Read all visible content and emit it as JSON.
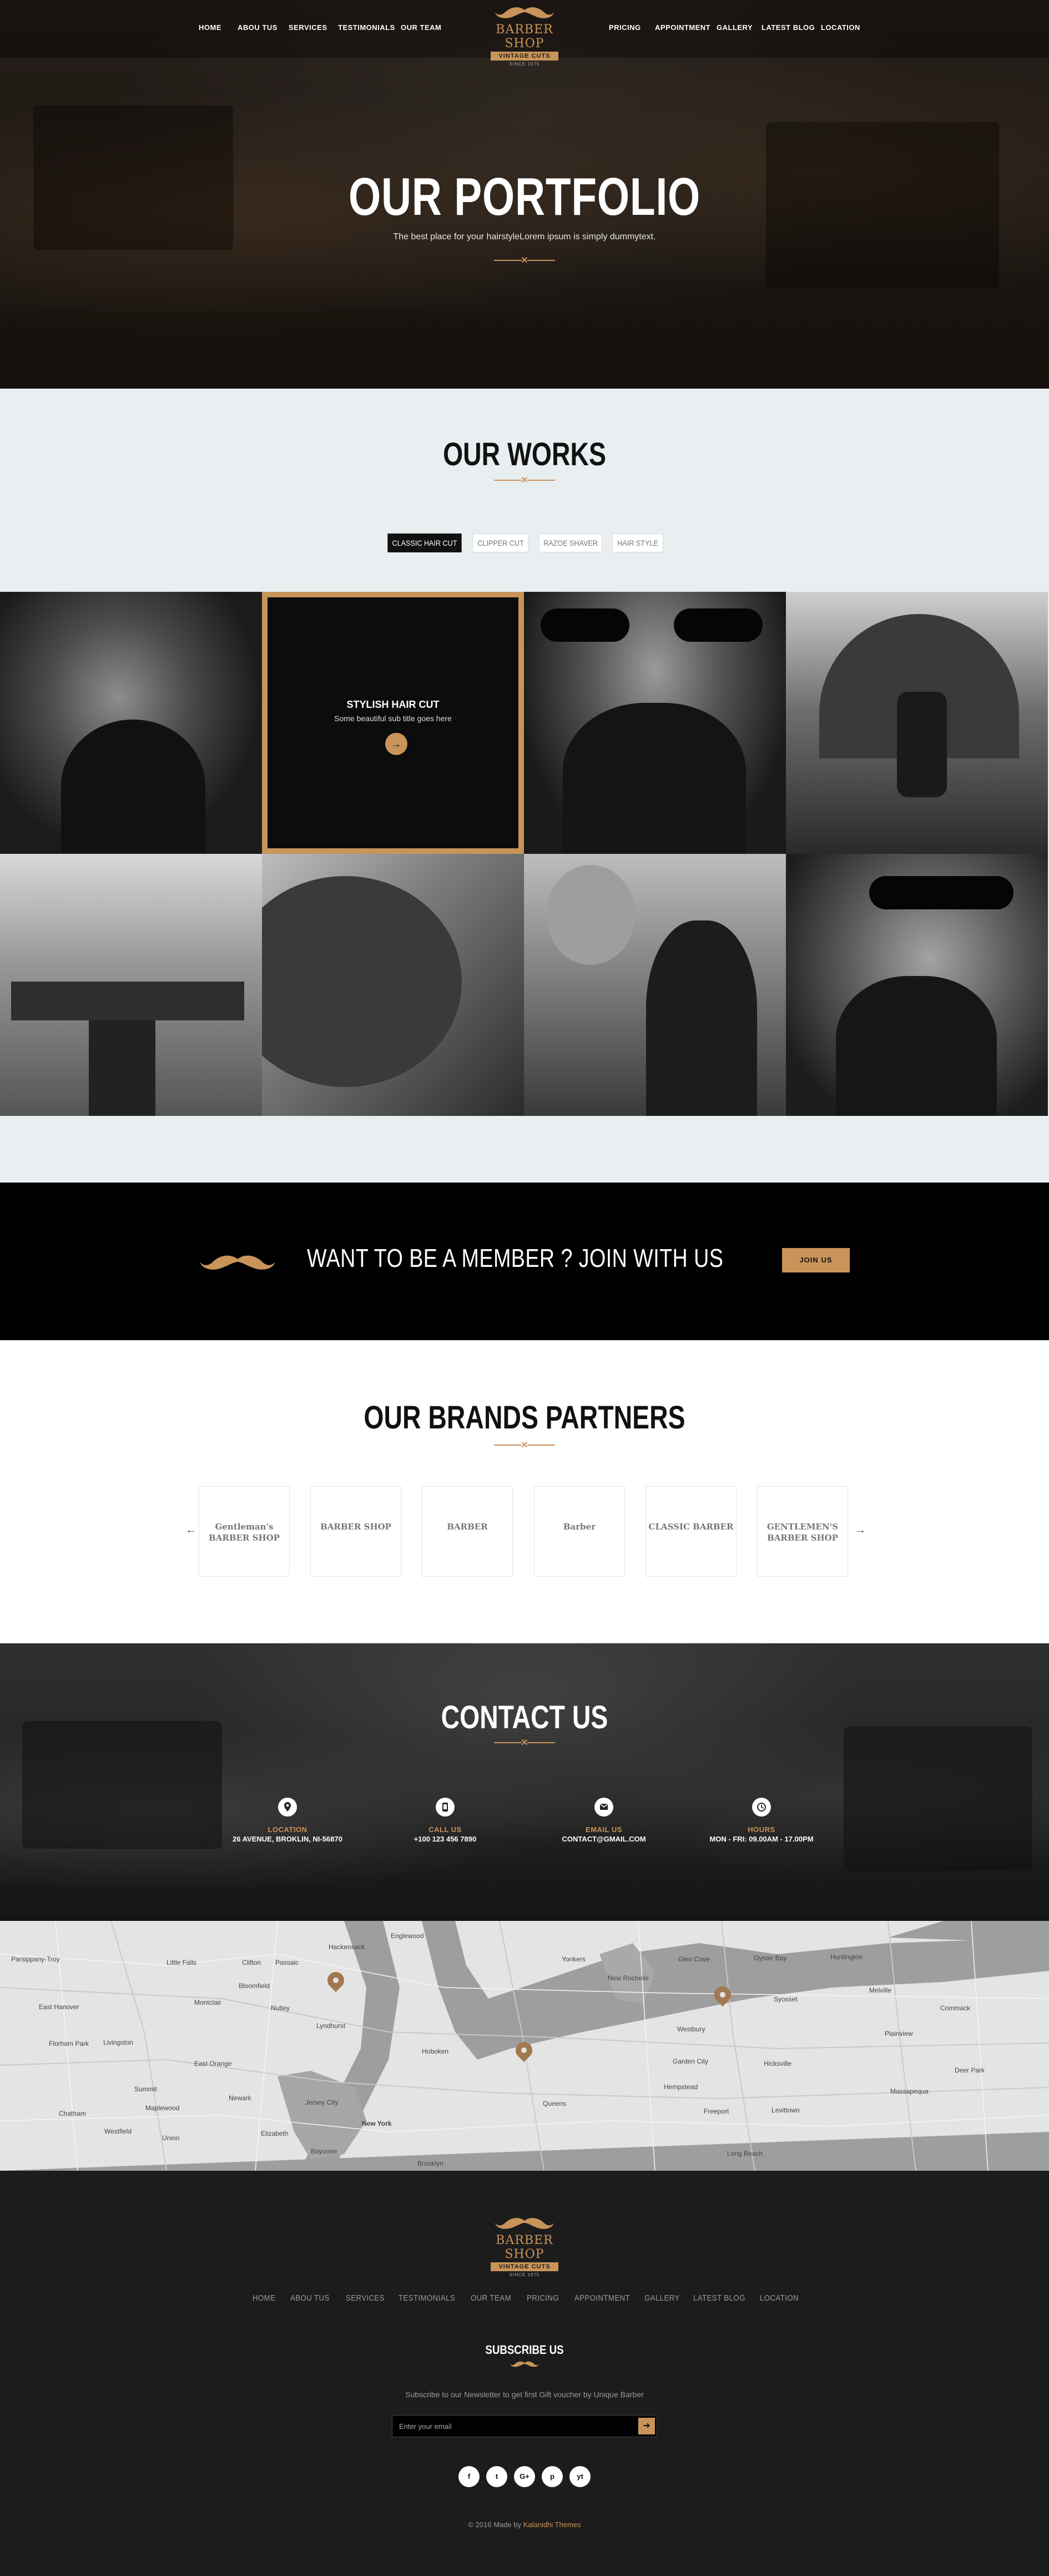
{
  "nav": {
    "left": [
      "HOME",
      "ABOU TUS",
      "SERVICES",
      "TESTIMONIALS",
      "OUR TEAM"
    ],
    "right": [
      "PRICING",
      "APPOINTMENT",
      "GALLERY",
      "LATEST BLOG",
      "LOCATION"
    ]
  },
  "logo": {
    "name": "BARBER SHOP",
    "ribbon": "VINTAGE CUTS",
    "tagline": "SINCE 1975"
  },
  "hero": {
    "title": "OUR PORTFOLIO",
    "subtitle": "The best place for your hairstyleLorem ipsum is simply dummytext."
  },
  "works": {
    "title": "OUR WORKS",
    "tabs": [
      "CLASSIC HAIR CUT",
      "CLIPPER CUT",
      "RAZOE SHAVER",
      "HAIR STYLE"
    ],
    "hover_tile": {
      "title": "STYLISH HAIR CUT",
      "subtitle": "Some beautiful sub title goes here",
      "icon": "arrow-right-icon"
    }
  },
  "member": {
    "text": "WANT TO BE A MEMBER ? JOIN WITH US",
    "button": "JOIN US"
  },
  "brands": {
    "title": "OUR BRANDS PARTNERS",
    "items": [
      "Gentleman's BARBER SHOP",
      "BARBER SHOP",
      "BARBER",
      "Barber",
      "CLASSIC BARBER",
      "GENTLEMEN'S BARBER SHOP"
    ]
  },
  "contact": {
    "title": "CONTACT US",
    "items": [
      {
        "label": "LOCATION",
        "value": "26 AVENUE, BROKLIN, NI-56870",
        "icon": "map-pin-icon"
      },
      {
        "label": "CALL US",
        "value": "+100 123 456 7890",
        "icon": "phone-icon"
      },
      {
        "label": "EMAIL US",
        "value": "CONTACT@GMAIL.COM",
        "icon": "envelope-icon"
      },
      {
        "label": "HOURS",
        "value": "MON - FRI: 09.00AM - 17.00PM",
        "icon": "clock-icon"
      }
    ]
  },
  "map": {
    "labels": [
      "Parsippany-Troy",
      "Little Falls",
      "Clifton",
      "Passaic",
      "Hackensack",
      "Englewood",
      "East Hanover",
      "Montclair",
      "Florham Park",
      "Livingston",
      "East Orange",
      "Newark",
      "Jersey City",
      "New York",
      "Hoboken",
      "Yonkers",
      "New Rochelle",
      "Glen Cove",
      "Oyster Bay",
      "Huntington",
      "Westbury",
      "Hicksville",
      "Hempstead",
      "Levittown",
      "Freeport",
      "Queens",
      "Brooklyn",
      "Garden City",
      "Plainview",
      "Massapequa",
      "Union",
      "Elizabeth",
      "Chatham",
      "Summit",
      "Westfield",
      "Maplewood",
      "Bloomfield",
      "Nutley",
      "Lyndhurst",
      "Bayonne",
      "Long Beach",
      "Commack",
      "Syosset",
      "Melville",
      "Deer Park"
    ]
  },
  "footer": {
    "nav": [
      "HOME",
      "ABOU TUS",
      "SERVICES",
      "TESTIMONIALS",
      "OUR TEAM",
      "PRICING",
      "APPOINTMENT",
      "GALLERY",
      "LATEST BLOG",
      "LOCATION"
    ],
    "subscribe_title": "SUBSCRIBE US",
    "subscribe_text": "Subscribe to our Newsletter to get first Gift voucher by Unique Barber",
    "email_placeholder": "Enter your email",
    "social": [
      "f",
      "t",
      "G+",
      "p",
      "yt"
    ],
    "copyright_prefix": "© 2016 Made by",
    "copyright_link": "Kalanidhi Themes"
  },
  "colors": {
    "accent": "#c9945a",
    "dark": "#1c1c1c",
    "light_bg": "#e9eef1"
  }
}
